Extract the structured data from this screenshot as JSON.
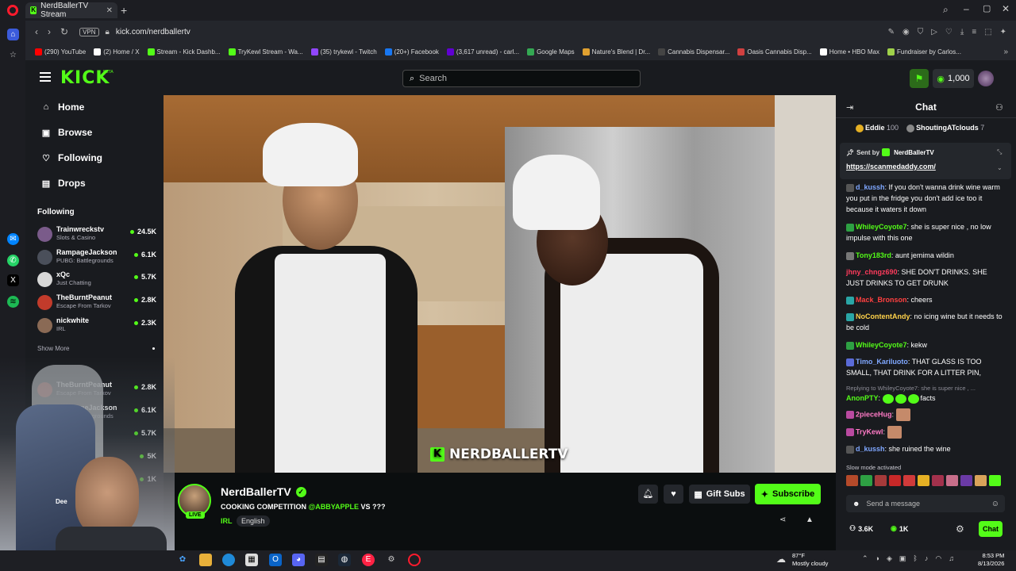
{
  "browser": {
    "tab_title": "NerdBallerTV Stream",
    "tab_close": "✕",
    "new_tab": "+",
    "url": "kick.com/nerdballertv",
    "vpn_label": "VPN",
    "bookmarks": [
      {
        "label": "(290) YouTube",
        "color": "#ff0000"
      },
      {
        "label": "(2) Home / X",
        "color": "#ffffff"
      },
      {
        "label": "Stream - Kick Dashb...",
        "color": "#53fc18"
      },
      {
        "label": "TryKewl Stream - Wa...",
        "color": "#53fc18"
      },
      {
        "label": "(35) trykewl - Twitch",
        "color": "#9146ff"
      },
      {
        "label": "(20+) Facebook",
        "color": "#1877f2"
      },
      {
        "label": "(3,617 unread) - carl...",
        "color": "#6001d2"
      },
      {
        "label": "Google Maps",
        "color": "#34a853"
      },
      {
        "label": "Nature's Blend | Dr...",
        "color": "#e0a030"
      },
      {
        "label": "Cannabis Dispensar...",
        "color": "#444444"
      },
      {
        "label": "Oasis Cannabis Disp...",
        "color": "#d04040"
      },
      {
        "label": "Home • HBO Max",
        "color": "#ffffff"
      },
      {
        "label": "Fundraiser by Carlos...",
        "color": "#9fd14a"
      }
    ]
  },
  "kick": {
    "logo": "KICK",
    "logo_beta": "BETA",
    "search_placeholder": "Search",
    "points": "1,000",
    "brand_color": "#53fc18"
  },
  "sidebar": {
    "nav": [
      {
        "label": "Home",
        "icon": "home-icon",
        "glyph": "⌂"
      },
      {
        "label": "Browse",
        "icon": "browse-icon",
        "glyph": "▣"
      },
      {
        "label": "Following",
        "icon": "heart-icon",
        "glyph": "♡"
      },
      {
        "label": "Drops",
        "icon": "drops-icon",
        "glyph": "▤"
      }
    ],
    "following_title": "Following",
    "following": [
      {
        "name": "Trainwreckstv",
        "category": "Slots & Casino",
        "viewers": "24.5K",
        "color": "#7a5b8a"
      },
      {
        "name": "RampageJackson",
        "category": "PUBG: Battlegrounds",
        "viewers": "6.1K",
        "color": "#4a4f5a"
      },
      {
        "name": "xQc",
        "category": "Just Chatting",
        "viewers": "5.7K",
        "color": "#d8d8d8"
      },
      {
        "name": "TheBurntPeanut",
        "category": "Escape From Tarkov",
        "viewers": "2.8K",
        "color": "#c23b2b"
      },
      {
        "name": "nickwhite",
        "category": "IRL",
        "viewers": "2.3K",
        "color": "#8a6a55"
      }
    ],
    "show_more": "Show More",
    "recommended": [
      {
        "name": "TheBurntPeanut",
        "category": "Escape From Tarkov",
        "viewers": "2.8K",
        "color": "#c23b2b"
      },
      {
        "name": "RampageJackson",
        "category": "PUBG: Battlegrounds",
        "viewers": "6.1K",
        "color": "#4a4f5a"
      },
      {
        "name": "xQc",
        "category": "Just Chatting",
        "viewers": "5.7K",
        "color": "#d8d8d8"
      },
      {
        "name": "",
        "category": "",
        "viewers": "5K",
        "color": "#6a6a6a"
      },
      {
        "name": "",
        "category": "",
        "viewers": "1K",
        "color": "#6a6a6a"
      }
    ]
  },
  "video": {
    "watermark": "NERDBALLERTV"
  },
  "stream": {
    "streamer": "NerdBallerTV",
    "live": "LIVE",
    "title_prefix": "COOKING COMPETITION ",
    "title_mention": "@ABBYAPPLE",
    "title_suffix": " VS ???",
    "category": "IRL",
    "language": "English",
    "gift_subs": "Gift Subs",
    "subscribe": "Subscribe"
  },
  "chat": {
    "title": "Chat",
    "top_gifters": [
      {
        "name": "Eddie",
        "count": "100"
      },
      {
        "name": "ShoutingATclouds",
        "count": "7"
      }
    ],
    "pinned_by_label": "Sent by",
    "pinned_by_user": "NerdBallerTV",
    "pinned_link": "https://scanmedaddy.com/",
    "messages": [
      {
        "user": "d_kussh",
        "color": "#7fa7ff",
        "badge": "#555555",
        "text": "If you don't wanna drink wine warm you put in the fridge you don't add ice too it because it waters it down"
      },
      {
        "user": "WhileyCoyote7",
        "color": "#53fc18",
        "badge": "#2ea043",
        "text": "she is super nice , no low impulse with this one"
      },
      {
        "user": "Tony183rd",
        "color": "#53fc18",
        "badge": "#777777",
        "text": "aunt jemima wildin"
      },
      {
        "user": "jhny_chngz690",
        "color": "#ff3b5c",
        "badge": "",
        "text": "SHE DON'T DRINKS. SHE JUST DRINKS TO GET DRUNK"
      },
      {
        "user": "Mack_Bronson",
        "color": "#ff4040",
        "badge": "#2aa6a6",
        "text": "cheers"
      },
      {
        "user": "NoContentAndy",
        "color": "#ffd24a",
        "badge": "#2aa6a6",
        "text": "no icing wine but it needs to be cold"
      },
      {
        "user": "WhileyCoyote7",
        "color": "#53fc18",
        "badge": "#2ea043",
        "text": "kekw"
      },
      {
        "user": "Timo_Kariluoto",
        "color": "#7fa7ff",
        "badge": "#5a6bd8",
        "text": "THAT GLASS IS TOO SMALL, THAT DRINK FOR A LITTER PIN,"
      }
    ],
    "reply_note": "Replying to WhileyCoyote7: she is super nice , ...",
    "messages_after": [
      {
        "user": "AnonPTY",
        "color": "#53fc18",
        "badge": "",
        "text": "facts"
      },
      {
        "user": "2pieceHug",
        "color": "#ff7ac6",
        "badge": "#b94aa0",
        "text": ""
      },
      {
        "user": "TryKewl",
        "color": "#ff7ac6",
        "badge": "#b94aa0",
        "text": ""
      },
      {
        "user": "d_kussh",
        "color": "#7fa7ff",
        "badge": "#555555",
        "text": "she ruined the wine"
      }
    ],
    "slow_mode": "Slow mode activated",
    "input_placeholder": "Send a message",
    "viewers": "3.6K",
    "points": "1K",
    "send": "Chat"
  },
  "webcam": {
    "label": "Dee"
  },
  "taskbar": {
    "weather_temp": "87°F",
    "weather_desc": "Mostly cloudy",
    "time": "8:53 PM",
    "date": "8/13/2026"
  }
}
